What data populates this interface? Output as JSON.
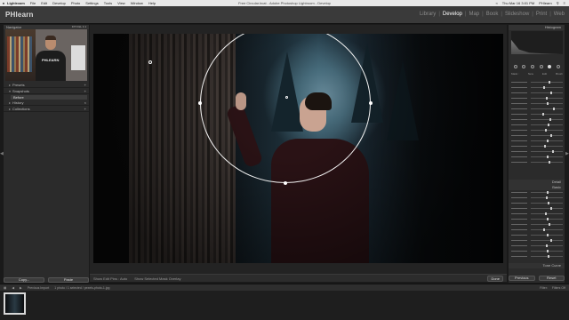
{
  "menubar": {
    "apple": "",
    "items": [
      "Lightroom",
      "File",
      "Edit",
      "Develop",
      "Photo",
      "Settings",
      "Tools",
      "View",
      "Window",
      "Help"
    ],
    "doc_title": "Free Circular.lrcat - Adobe Photoshop Lightroom - Develop",
    "clock": "Thu Mar 16  3:01 PM",
    "user": "PHlearn"
  },
  "header": {
    "brand": "PHlearn",
    "modules": [
      "Library",
      "Develop",
      "Map",
      "Book",
      "Slideshow",
      "Print",
      "Web"
    ],
    "active_module": "Develop"
  },
  "left_panel": {
    "navigator_label": "Navigator",
    "navigator_zoom": "FIT  FILL  1:1",
    "nav_logo": "PHLEARN",
    "sections": [
      {
        "label": "Presets"
      },
      {
        "label": "Snapshots"
      },
      {
        "label": "History"
      },
      {
        "label": "Collections"
      }
    ],
    "selected_sub": "Before",
    "copy_label": "Copy...",
    "paste_label": "Paste"
  },
  "toolbar": {
    "show_edit_pins": "Show Edit Pins : Auto",
    "overlay": "Show Selected Mask Overlay",
    "done_label": "Done"
  },
  "right_panel": {
    "histogram_label": "Histogram",
    "mask_tabs": [
      "Mask :",
      "New",
      "Edit",
      "Brush"
    ],
    "tone_section": "Tone",
    "detail_section": "Detail",
    "basic_label": "Basic",
    "tone_curve_label": "Tone Curve",
    "previous_label": "Previous",
    "reset_label": "Reset"
  },
  "filmstrip_bar": {
    "source": "Previous Import",
    "count": "1 photo / 1 selected / pexels-photo-1.jpg",
    "filter": "Filter:",
    "filters_off": "Filters Off"
  },
  "colors": {
    "accent": "#ffffff",
    "panel": "#2b2b2b",
    "header": "#3a3a3a"
  }
}
